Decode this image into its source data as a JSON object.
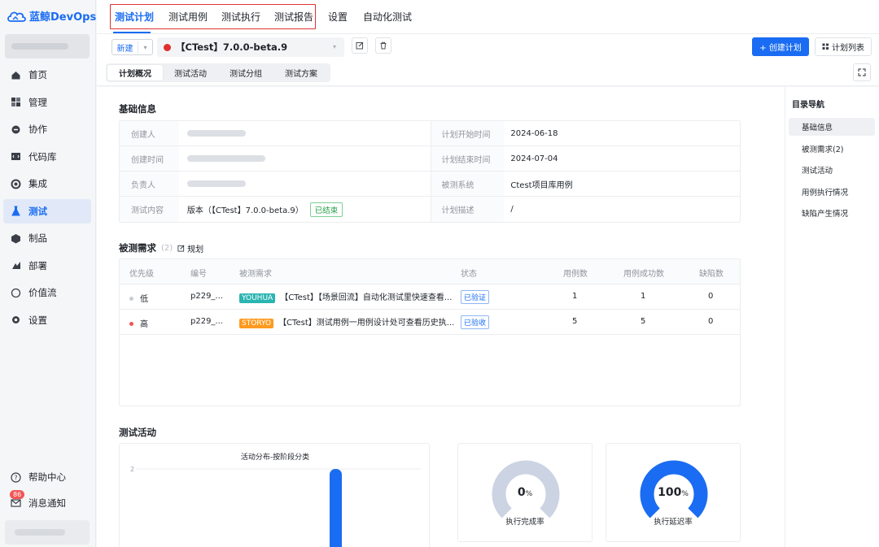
{
  "brand": {
    "name": "蓝鲸DevOps",
    "color": "#1a6cf2"
  },
  "sidebar": {
    "items": [
      {
        "label": "首页",
        "icon": "home-icon"
      },
      {
        "label": "管理",
        "icon": "manage-icon"
      },
      {
        "label": "协作",
        "icon": "collaborate-icon"
      },
      {
        "label": "代码库",
        "icon": "code-repo-icon"
      },
      {
        "label": "集成",
        "icon": "integration-icon"
      },
      {
        "label": "测试",
        "icon": "test-flask-icon",
        "active": true
      },
      {
        "label": "制品",
        "icon": "artifact-box-icon"
      },
      {
        "label": "部署",
        "icon": "deploy-icon"
      },
      {
        "label": "价值流",
        "icon": "value-stream-icon"
      },
      {
        "label": "设置",
        "icon": "gear-icon"
      }
    ],
    "help": "帮助中心",
    "notifications": "消息通知",
    "notification_count": "86"
  },
  "topnav": {
    "tabs": [
      "测试计划",
      "测试用例",
      "测试执行",
      "测试报告",
      "设置",
      "自动化测试"
    ],
    "active_index": 0
  },
  "toolbar": {
    "new_label": "新建",
    "plan_name": "【CTest】7.0.0-beta.9",
    "create_plan": "+ 创建计划",
    "plan_list": "计划列表"
  },
  "subtabs": [
    "计划概况",
    "测试活动",
    "测试分组",
    "测试方案"
  ],
  "basic": {
    "title": "基础信息",
    "creator_label": "创建人",
    "created_time_label": "创建时间",
    "owner_label": "负责人",
    "content_label": "测试内容",
    "content_value": "版本（【CTest】7.0.0-beta.9）",
    "content_status": "已结束",
    "start_label": "计划开始时间",
    "start_value": "2024-06-18",
    "end_label": "计划结束时间",
    "end_value": "2024-07-04",
    "system_label": "被测系统",
    "system_value": "Ctest项目库用例",
    "desc_label": "计划描述",
    "desc_value": "/"
  },
  "requirements": {
    "title": "被测需求",
    "count": "(2)",
    "plan_link": "规划",
    "columns": [
      "优先级",
      "编号",
      "被测需求",
      "状态",
      "用例数",
      "用例成功数",
      "缺陷数"
    ],
    "rows": [
      {
        "priority": "低",
        "priority_color": "#c9ccd1",
        "id": "p229_...",
        "type": "YOUHUA",
        "type_color": "#2bb5b1",
        "name": "【CTest】【场景回流】自动化测试里快速查看...",
        "status": "已验证",
        "cases": "1",
        "success": "1",
        "defects": "0"
      },
      {
        "priority": "高",
        "priority_color": "#f25555",
        "id": "p229_...",
        "type": "STORYO",
        "type_color": "#ff9a1f",
        "name": "【CTest】测试用例一用例设计处可查看历史执...",
        "status": "已验收",
        "cases": "5",
        "success": "5",
        "defects": "0"
      }
    ]
  },
  "activity": {
    "title": "测试活动",
    "completion_value": "0",
    "completion_unit": "%",
    "completion_label": "执行完成率",
    "delay_value": "100",
    "delay_unit": "%",
    "delay_label": "执行延迟率",
    "gauge_track_color": "#ccd4e3",
    "gauge_fill_color": "#1a6cf2"
  },
  "chart_data": {
    "type": "bar",
    "title": "活动分布-按阶段分类",
    "y_ticks": [
      "2"
    ],
    "ylim": [
      0,
      2
    ],
    "values": [
      2
    ],
    "categories": [
      ""
    ],
    "color": "#1a6cf2"
  },
  "toc": {
    "title": "目录导航",
    "items": [
      "基础信息",
      "被测需求(2)",
      "测试活动",
      "用例执行情况",
      "缺陷产生情况"
    ]
  }
}
